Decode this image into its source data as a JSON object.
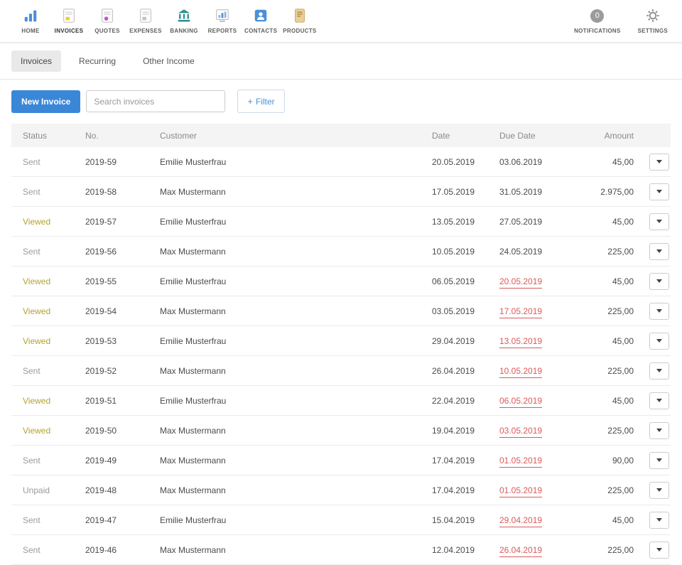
{
  "colors": {
    "accent_blue": "#3a87d8",
    "overdue_red": "#d95b5b",
    "status": {
      "Sent": "#9b9b9b",
      "Viewed": "#b4a233",
      "Unpaid": "#9b9b9b"
    }
  },
  "nav": {
    "items": [
      {
        "label": "HOME",
        "icon": "home",
        "active": false
      },
      {
        "label": "INVOICES",
        "icon": "invoices",
        "active": true
      },
      {
        "label": "QUOTES",
        "icon": "quotes",
        "active": false
      },
      {
        "label": "EXPENSES",
        "icon": "expenses",
        "active": false
      },
      {
        "label": "BANKING",
        "icon": "banking",
        "active": false
      },
      {
        "label": "REPORTS",
        "icon": "reports",
        "active": false
      },
      {
        "label": "CONTACTS",
        "icon": "contacts",
        "active": false
      },
      {
        "label": "PRODUCTS",
        "icon": "products",
        "active": false
      }
    ],
    "notifications": {
      "label": "NOTIFICATIONS",
      "badge": "0"
    },
    "settings": {
      "label": "SETTINGS"
    }
  },
  "tabs": [
    {
      "label": "Invoices",
      "active": true
    },
    {
      "label": "Recurring",
      "active": false
    },
    {
      "label": "Other Income",
      "active": false
    }
  ],
  "toolbar": {
    "new_invoice_label": "New Invoice",
    "search_placeholder": "Search invoices",
    "filter_plus": "+",
    "filter_label": "Filter"
  },
  "table": {
    "headers": [
      "Status",
      "No.",
      "Customer",
      "Date",
      "Due Date",
      "Amount"
    ],
    "rows": [
      {
        "status": "Sent",
        "no": "2019-59",
        "customer": "Emilie Musterfrau",
        "date": "20.05.2019",
        "due_date": "03.06.2019",
        "overdue": false,
        "amount": "45,00"
      },
      {
        "status": "Sent",
        "no": "2019-58",
        "customer": "Max Mustermann",
        "date": "17.05.2019",
        "due_date": "31.05.2019",
        "overdue": false,
        "amount": "2.975,00"
      },
      {
        "status": "Viewed",
        "no": "2019-57",
        "customer": "Emilie Musterfrau",
        "date": "13.05.2019",
        "due_date": "27.05.2019",
        "overdue": false,
        "amount": "45,00"
      },
      {
        "status": "Sent",
        "no": "2019-56",
        "customer": "Max Mustermann",
        "date": "10.05.2019",
        "due_date": "24.05.2019",
        "overdue": false,
        "amount": "225,00"
      },
      {
        "status": "Viewed",
        "no": "2019-55",
        "customer": "Emilie Musterfrau",
        "date": "06.05.2019",
        "due_date": "20.05.2019",
        "overdue": true,
        "amount": "45,00"
      },
      {
        "status": "Viewed",
        "no": "2019-54",
        "customer": "Max Mustermann",
        "date": "03.05.2019",
        "due_date": "17.05.2019",
        "overdue": true,
        "amount": "225,00"
      },
      {
        "status": "Viewed",
        "no": "2019-53",
        "customer": "Emilie Musterfrau",
        "date": "29.04.2019",
        "due_date": "13.05.2019",
        "overdue": true,
        "amount": "45,00"
      },
      {
        "status": "Sent",
        "no": "2019-52",
        "customer": "Max Mustermann",
        "date": "26.04.2019",
        "due_date": "10.05.2019",
        "overdue": true,
        "amount": "225,00"
      },
      {
        "status": "Viewed",
        "no": "2019-51",
        "customer": "Emilie Musterfrau",
        "date": "22.04.2019",
        "due_date": "06.05.2019",
        "overdue": true,
        "amount": "45,00"
      },
      {
        "status": "Viewed",
        "no": "2019-50",
        "customer": "Max Mustermann",
        "date": "19.04.2019",
        "due_date": "03.05.2019",
        "overdue": true,
        "amount": "225,00"
      },
      {
        "status": "Sent",
        "no": "2019-49",
        "customer": "Max Mustermann",
        "date": "17.04.2019",
        "due_date": "01.05.2019",
        "overdue": true,
        "amount": "90,00"
      },
      {
        "status": "Unpaid",
        "no": "2019-48",
        "customer": "Max Mustermann",
        "date": "17.04.2019",
        "due_date": "01.05.2019",
        "overdue": true,
        "amount": "225,00"
      },
      {
        "status": "Sent",
        "no": "2019-47",
        "customer": "Emilie Musterfrau",
        "date": "15.04.2019",
        "due_date": "29.04.2019",
        "overdue": true,
        "amount": "45,00"
      },
      {
        "status": "Sent",
        "no": "2019-46",
        "customer": "Max Mustermann",
        "date": "12.04.2019",
        "due_date": "26.04.2019",
        "overdue": true,
        "amount": "225,00"
      }
    ]
  }
}
